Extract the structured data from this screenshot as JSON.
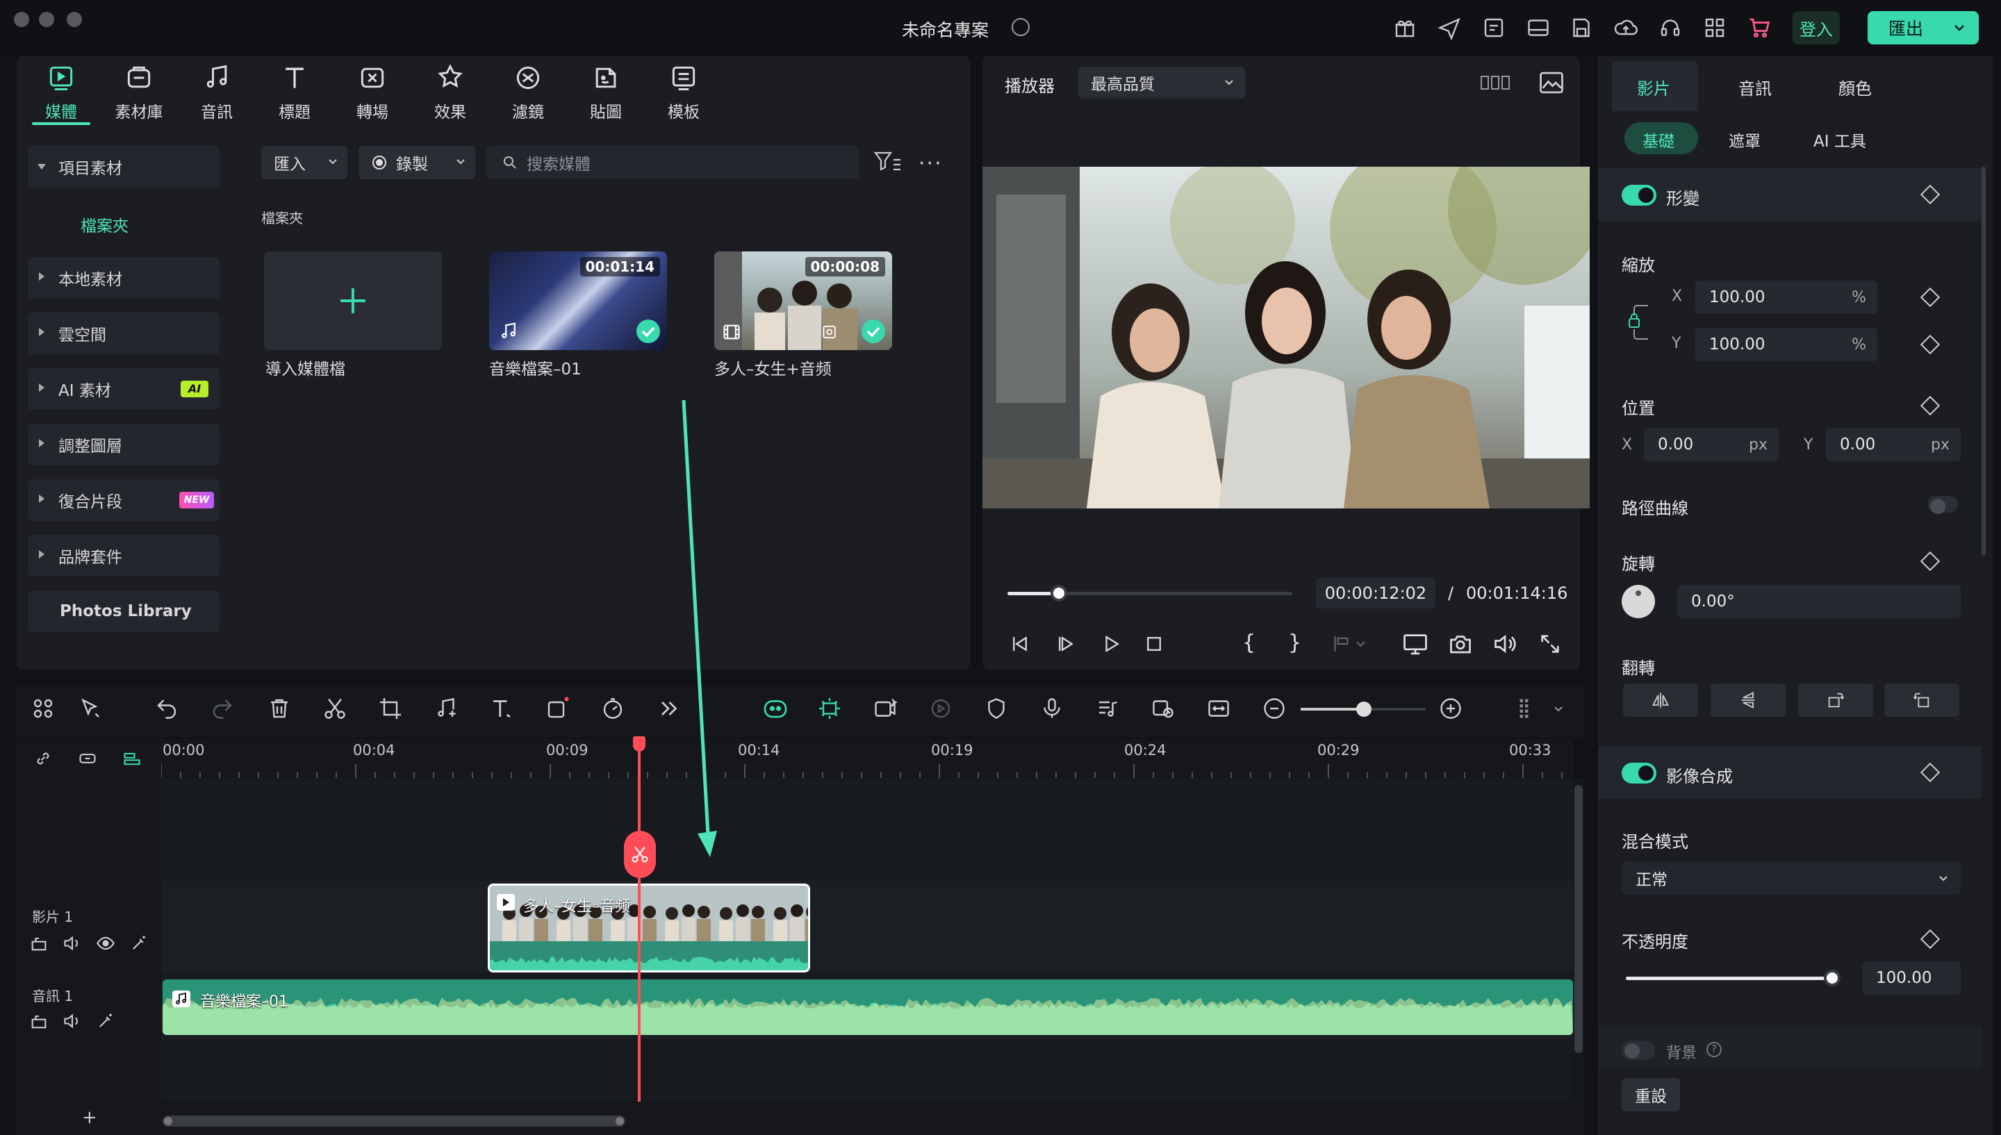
{
  "window": {
    "title": "未命名專案"
  },
  "header": {
    "login_label": "登入",
    "export_label": "匯出"
  },
  "media_tabs": [
    {
      "label": "媒體",
      "icon": "media-icon"
    },
    {
      "label": "素材庫",
      "icon": "stock-icon"
    },
    {
      "label": "音訊",
      "icon": "music-icon"
    },
    {
      "label": "標題",
      "icon": "title-icon"
    },
    {
      "label": "轉場",
      "icon": "transition-icon"
    },
    {
      "label": "效果",
      "icon": "effects-icon"
    },
    {
      "label": "濾鏡",
      "icon": "filter-icon"
    },
    {
      "label": "貼圖",
      "icon": "sticker-icon"
    },
    {
      "label": "模板",
      "icon": "template-icon"
    }
  ],
  "sidebar": {
    "items": [
      {
        "label": "項目素材"
      },
      {
        "label": "檔案夾"
      },
      {
        "label": "本地素材"
      },
      {
        "label": "雲空間"
      },
      {
        "label": "AI 素材",
        "badge": "AI"
      },
      {
        "label": "調整圖層"
      },
      {
        "label": "復合片段",
        "badge": "NEW"
      },
      {
        "label": "品牌套件"
      },
      {
        "label": "Photos Library"
      }
    ]
  },
  "media_toolbar": {
    "import_label": "匯入",
    "record_label": "錄製",
    "search_placeholder": "搜索媒體"
  },
  "media_grid": {
    "folder_label": "檔案夾",
    "items": [
      {
        "label": "導入媒體檔",
        "duration": ""
      },
      {
        "label": "音樂檔案–01",
        "duration": "00:01:14"
      },
      {
        "label": "多人–女生+音频",
        "duration": "00:00:08"
      }
    ]
  },
  "player": {
    "label": "播放器",
    "quality": "最高品質",
    "current_time": "00:00:12:02",
    "separator": "/",
    "total_time": "00:01:14:16",
    "progress": 0.18
  },
  "inspector": {
    "tabs": [
      "影片",
      "音訊",
      "顏色"
    ],
    "subtabs": [
      "基礎",
      "遮罩",
      "AI 工具"
    ],
    "transform_label": "形變",
    "scale_label": "縮放",
    "scale_x": "100.00",
    "scale_y": "100.00",
    "percent_unit": "%",
    "position_label": "位置",
    "pos_x": "0.00",
    "pos_y": "0.00",
    "px_unit": "px",
    "x_axis": "X",
    "y_axis": "Y",
    "path_curve_label": "路徑曲線",
    "rotate_label": "旋轉",
    "rotate_value": "0.00°",
    "flip_label": "翻轉",
    "compositing_label": "影像合成",
    "blend_mode_label": "混合模式",
    "blend_mode_value": "正常",
    "opacity_label": "不透明度",
    "opacity_value": "100.00",
    "opacity_fraction": 0.99,
    "background_label": "背景",
    "reset_label": "重設"
  },
  "timeline": {
    "ruler": [
      "00:00",
      "00:04",
      "00:09",
      "00:14",
      "00:19",
      "00:24",
      "00:29",
      "00:33"
    ],
    "video_track_label": "影片 1",
    "audio_track_label": "音訊 1",
    "video_clip_label": "多人–女生–音频",
    "audio_clip_label": "音樂檔案–01",
    "add_track_label": "+"
  },
  "colors": {
    "accent": "#37d9ad",
    "playhead": "#ff4d57",
    "panel": "#1b1d22",
    "background": "#101217"
  }
}
